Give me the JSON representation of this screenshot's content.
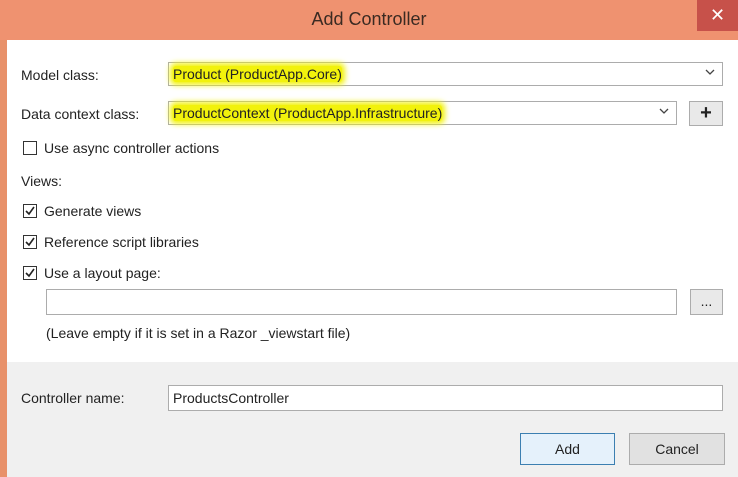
{
  "dialog": {
    "title": "Add Controller",
    "close_glyph": "✕"
  },
  "form": {
    "model_class": {
      "label": "Model class:",
      "value": "Product (ProductApp.Core)"
    },
    "data_context_class": {
      "label": "Data context class:",
      "value": "ProductContext (ProductApp.Infrastructure)",
      "add_glyph": "+"
    },
    "async_actions": {
      "label": "Use async controller actions",
      "checked": false
    },
    "views_label": "Views:",
    "generate_views": {
      "label": "Generate views",
      "checked": true
    },
    "reference_scripts": {
      "label": "Reference script libraries",
      "checked": true
    },
    "use_layout": {
      "label": "Use a layout page:",
      "checked": true
    },
    "layout_path": {
      "value": "",
      "browse_label": "..."
    },
    "layout_hint": "(Leave empty if it is set in a Razor _viewstart file)",
    "controller_name": {
      "label": "Controller name:",
      "value": "ProductsController"
    }
  },
  "buttons": {
    "add": "Add",
    "cancel": "Cancel"
  },
  "colors": {
    "title_bar": "#ef9270",
    "close": "#c7514a",
    "highlight": "#f2f20c"
  }
}
